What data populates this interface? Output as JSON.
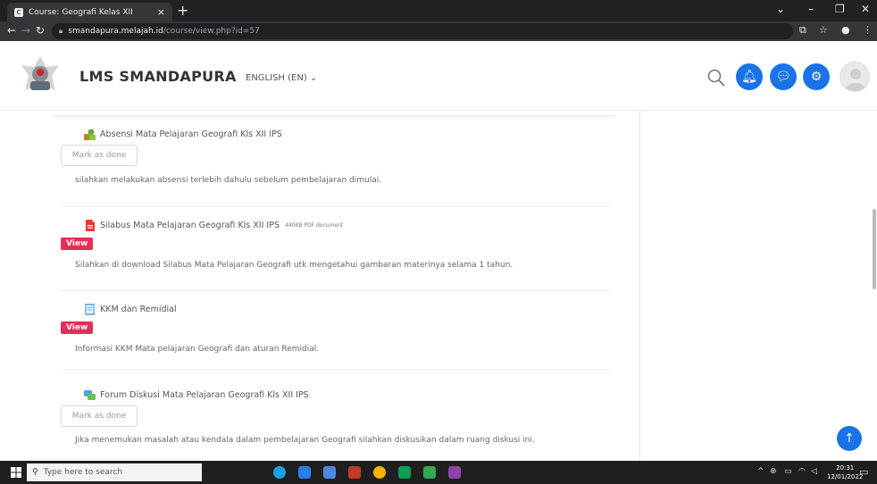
{
  "browser": {
    "tab_title": "Course: Geografi Kelas XII",
    "tab_favicon": "C",
    "new_tab": "+",
    "url_host": "smandapura.melajah.id",
    "url_path": "/course/view.php?id=57",
    "minimize": "⌄",
    "minimize2": "–",
    "maximize": "❐",
    "close": "✕"
  },
  "header": {
    "site_name": "LMS SMANDAPURA",
    "language": "ENGLISH (EN) ⌄",
    "accent": "#1a73e8"
  },
  "activities": [
    {
      "title": "Absensi Mata Pelajaran Geografi Kls XII IPS",
      "subtitle": "",
      "icon": "attendance-icon",
      "action_label": "Mark as done",
      "action_type": "mark-done",
      "description": "silahkan melakukan absensi terlebih dahulu sebelum pembelajaran dimulai."
    },
    {
      "title": "Silabus Mata Pelajaran Geografi Kls XII IPS",
      "subtitle": "440KB PDF document",
      "icon": "pdf-icon",
      "action_label": "View",
      "action_type": "view",
      "description": "Silahkan di download Silabus Mata  Pelajaran Geografi  utk mengetahui gambaran materinya selama 1 tahun."
    },
    {
      "title": "KKM dan Remidial",
      "subtitle": "",
      "icon": "page-icon",
      "action_label": "View",
      "action_type": "view",
      "description": "Informasi KKM Mata pelajaran Geografi dan aturan Remidial."
    },
    {
      "title": "Forum Diskusi Mata Pelajaran Geografi Kls XII IPS",
      "subtitle": "",
      "icon": "forum-icon",
      "action_label": "Mark as done",
      "action_type": "mark-done",
      "description": "Jika menemukan masalah atau kendala dalam pembelajaran  Geografi silahkan diskusikan dalam ruang diskusi  ini."
    }
  ],
  "taskbar": {
    "search_placeholder": "Type here to search",
    "clock_time": "20:31",
    "clock_date": "12/01/2022"
  },
  "colors": {
    "view_badge": "#e62e57",
    "mark_done_border": "#d8d8d8"
  }
}
